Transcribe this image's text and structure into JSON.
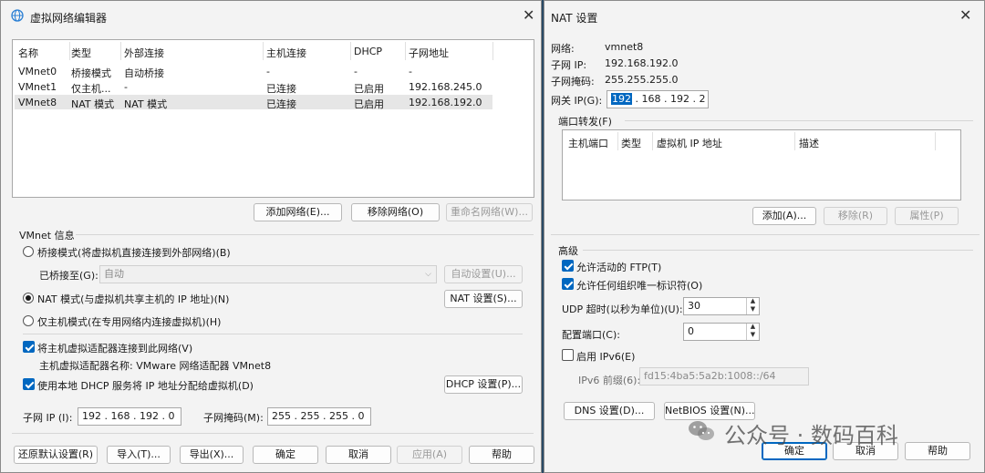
{
  "left_window": {
    "title": "虚拟网络编辑器",
    "table": {
      "headers": [
        "名称",
        "类型",
        "外部连接",
        "主机连接",
        "DHCP",
        "子网地址"
      ],
      "rows": [
        [
          "VMnet0",
          "桥接模式",
          "自动桥接",
          "-",
          "-",
          "-"
        ],
        [
          "VMnet1",
          "仅主机...",
          "-",
          "已连接",
          "已启用",
          "192.168.245.0"
        ],
        [
          "VMnet8",
          "NAT 模式",
          "NAT 模式",
          "已连接",
          "已启用",
          "192.168.192.0"
        ]
      ]
    },
    "add_network": "添加网络(E)...",
    "remove_network": "移除网络(O)",
    "rename_network": "重命名网络(W)...",
    "vmnet_info": "VMnet 信息",
    "bridge_mode": "桥接模式(将虚拟机直接连接到外部网络)(B)",
    "bridged_to_label": "已桥接至(G):",
    "bridged_to_value": "自动",
    "auto_settings": "自动设置(U)...",
    "nat_mode": "NAT 模式(与虚拟机共享主机的 IP 地址)(N)",
    "nat_settings": "NAT 设置(S)...",
    "host_only": "仅主机模式(在专用网络内连接虚拟机)(H)",
    "connect_adapter": "将主机虚拟适配器连接到此网络(V)",
    "adapter_name": "主机虚拟适配器名称: VMware 网络适配器 VMnet8",
    "use_dhcp": "使用本地 DHCP 服务将 IP 地址分配给虚拟机(D)",
    "dhcp_settings": "DHCP 设置(P)...",
    "subnet_ip_label": "子网 IP (I):",
    "subnet_ip_value": "192 . 168 . 192 . 0",
    "subnet_mask_label": "子网掩码(M):",
    "subnet_mask_value": "255 . 255 . 255 . 0",
    "restore_defaults": "还原默认设置(R)",
    "import": "导入(T)...",
    "export": "导出(X)...",
    "ok": "确定",
    "cancel": "取消",
    "apply": "应用(A)",
    "help": "帮助"
  },
  "right_window": {
    "title": "NAT 设置",
    "network_label": "网络:",
    "network_value": "vmnet8",
    "subnet_ip_label": "子网 IP:",
    "subnet_ip_value": "192.168.192.0",
    "subnet_mask_label": "子网掩码:",
    "subnet_mask_value": "255.255.255.0",
    "gateway_label": "网关 IP(G):",
    "gateway_first": "192",
    "gateway_rest": " . 168 . 192 . 2",
    "port_forwarding": "端口转发(F)",
    "pf_headers": [
      "主机端口",
      "类型",
      "虚拟机 IP 地址",
      "描述"
    ],
    "add": "添加(A)...",
    "remove": "移除(R)",
    "properties": "属性(P)",
    "advanced": "高级",
    "allow_ftp": "允许活动的 FTP(T)",
    "allow_ouid": "允许任何组织唯一标识符(O)",
    "udp_timeout_label": "UDP 超时(以秒为单位)(U):",
    "udp_timeout_value": "30",
    "config_port_label": "配置端口(C):",
    "config_port_value": "0",
    "enable_ipv6": "启用 IPv6(E)",
    "ipv6_prefix_label": "IPv6 前缀(6):",
    "ipv6_prefix_value": "fd15:4ba5:5a2b:1008::/64",
    "dns_settings": "DNS 设置(D)...",
    "netbios_settings": "NetBIOS 设置(N)...",
    "ok": "确定",
    "cancel": "取消",
    "help": "帮助"
  },
  "watermark": "公众号 · 数码百科"
}
